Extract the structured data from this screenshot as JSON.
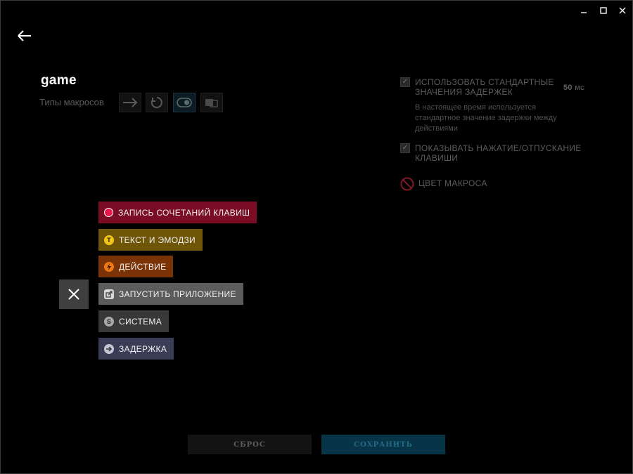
{
  "window": {
    "minimize_icon": "minimize-icon",
    "maximize_icon": "maximize-icon",
    "close_icon": "close-icon"
  },
  "nav": {
    "back_icon": "arrow-left-icon"
  },
  "macro": {
    "name": "game",
    "types_label": "Типы макросов",
    "type_icons": [
      "arrow-right-icon",
      "repeat-icon",
      "toggle-icon",
      "hold-icon"
    ]
  },
  "settings": {
    "default_delay_label_line1": "ИСПОЛЬЗОВАТЬ СТАНДАРТНЫЕ",
    "default_delay_label_line2": "ЗНАЧЕНИЯ ЗАДЕРЖЕК",
    "delay_value": "50",
    "delay_unit": "мс",
    "delay_note_line1": "В настоящее время используется",
    "delay_note_line2": "стандартное значение задержки между",
    "delay_note_line3": "действиями",
    "show_press_label_line1": "ПОКАЗЫВАТЬ НАЖАТИЕ/ОТПУСКАНИЕ",
    "show_press_label_line2": "КЛАВИШИ",
    "macro_color_label": "ЦВЕТ МАКРОСА"
  },
  "menu": {
    "items": [
      {
        "label": "ЗАПИСЬ СОЧЕТАНИЙ КЛАВИШ",
        "icon": "record-icon",
        "color": "#7a0c25",
        "icon_color": "#e8194a"
      },
      {
        "label": "ТЕКСТ И ЭМОДЗИ",
        "icon": "text-icon",
        "glyph": "T",
        "color": "#6e5508",
        "icon_color": "#f2c418"
      },
      {
        "label": "ДЕЙСТВИЕ",
        "icon": "lightning-icon",
        "glyph": "⚡",
        "color": "#7a3306",
        "icon_color": "#f07a12"
      },
      {
        "label": "ЗАПУСТИТЬ ПРИЛОЖЕНИЕ",
        "icon": "launch-app-icon",
        "glyph": "↗",
        "color": "#5c5c5c",
        "icon_color": "#d8d8d8"
      },
      {
        "label": "СИСТЕМА",
        "icon": "system-icon",
        "glyph": "S",
        "color": "#383838",
        "icon_color": "#a8a8a8"
      },
      {
        "label": "ЗАДЕРЖКА",
        "icon": "delay-icon",
        "glyph": "→",
        "color": "#3a3d55",
        "icon_color": "#c6c6d6"
      }
    ],
    "close_icon": "close-icon"
  },
  "footer": {
    "reset_label": "СБРОС",
    "save_label": "СОХРАНИТЬ"
  },
  "colors": {
    "save_bg": "#073447",
    "save_text": "#226a86",
    "reset_bg": "#131313",
    "reset_text": "#5e5e5e"
  }
}
